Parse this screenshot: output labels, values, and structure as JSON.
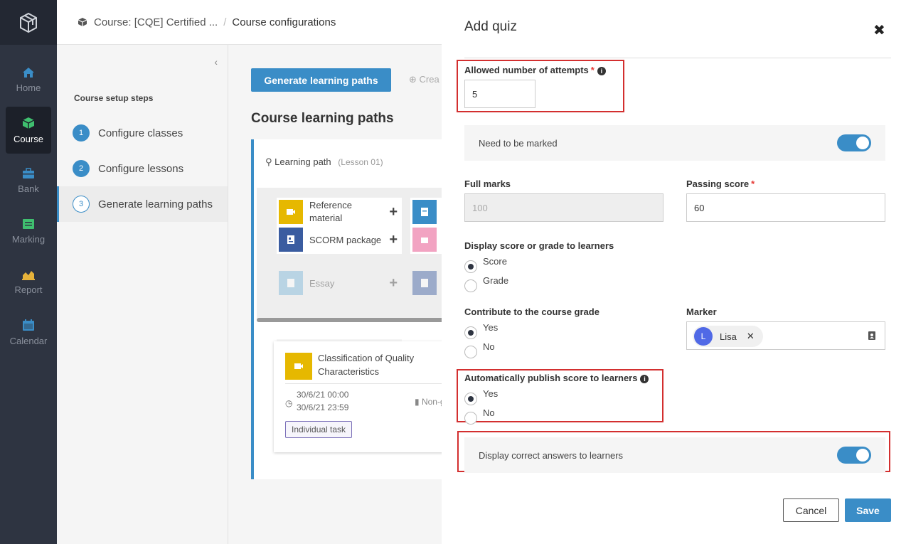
{
  "nav": {
    "items": [
      {
        "label": "Home",
        "icon": "home-icon",
        "color": "#3a8dc7"
      },
      {
        "label": "Course",
        "icon": "cube-icon",
        "color": "#3fbf6f"
      },
      {
        "label": "Bank",
        "icon": "briefcase-icon",
        "color": "#3a8dc7"
      },
      {
        "label": "Marking",
        "icon": "list-icon",
        "color": "#3fbf6f"
      },
      {
        "label": "Report",
        "icon": "chart-icon",
        "color": "#e6b23a"
      },
      {
        "label": "Calendar",
        "icon": "calendar-icon",
        "color": "#3a8dc7"
      }
    ]
  },
  "header": {
    "crumb1": "Course: [CQE] Certified ...",
    "separator": "/",
    "crumb2": "Course configurations"
  },
  "steps": {
    "title": "Course setup steps",
    "items": [
      {
        "num": "1",
        "label": "Configure classes"
      },
      {
        "num": "2",
        "label": "Configure lessons"
      },
      {
        "num": "3",
        "label": "Generate learning paths"
      }
    ]
  },
  "main": {
    "generate_label": "Generate learning paths",
    "create_label": "Crea",
    "section_title": "Course learning paths",
    "learning_path": {
      "label": "Learning path",
      "sub": "(Lesson 01)"
    },
    "tiles": [
      {
        "label": "Reference material"
      },
      {
        "label": "SCORM package"
      },
      {
        "label": "Essay"
      }
    ],
    "lesson": {
      "title": "Classification of Quality Characteristics",
      "start": "30/6/21 00:00",
      "end": "30/6/21 23:59",
      "grade": "Non-gra",
      "badge": "Individual task"
    }
  },
  "drawer": {
    "title": "Add quiz",
    "attempts": {
      "label": "Allowed number of attempts",
      "required": "*",
      "value": "5"
    },
    "need_marked": {
      "label": "Need to be marked",
      "on": true
    },
    "full_marks": {
      "label": "Full marks",
      "placeholder": "100"
    },
    "passing_score": {
      "label": "Passing score",
      "required": "*",
      "value": "60"
    },
    "display_score": {
      "label": "Display score or grade to learners",
      "options": [
        "Score",
        "Grade"
      ],
      "selected": "Score"
    },
    "contribute": {
      "label": "Contribute to the course grade",
      "options": [
        "Yes",
        "No"
      ],
      "selected": "Yes"
    },
    "marker": {
      "label": "Marker",
      "user_initial": "L",
      "user_name": "Lisa"
    },
    "auto_publish": {
      "label": "Automatically publish score to learners",
      "options": [
        "Yes",
        "No"
      ],
      "selected": "Yes"
    },
    "display_correct": {
      "label": "Display correct answers to learners",
      "on": true
    },
    "cancel_label": "Cancel",
    "save_label": "Save"
  },
  "colors": {
    "accent": "#3a8dc7",
    "highlight": "#d32f2f",
    "sidebar": "#2e3441"
  }
}
